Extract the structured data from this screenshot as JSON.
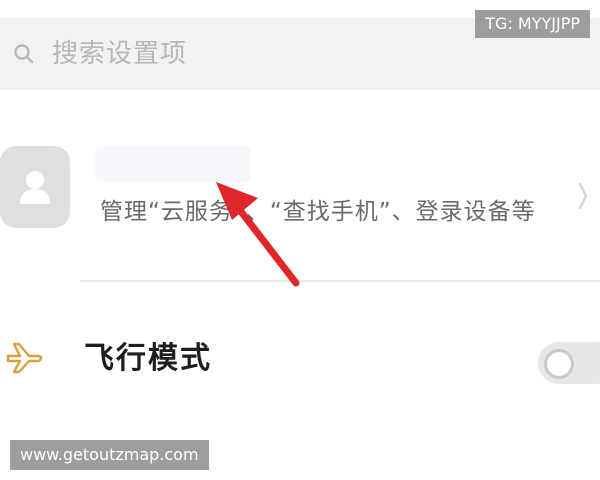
{
  "search": {
    "placeholder": "搜索设置项"
  },
  "watermarks": {
    "top": "TG: MYYJJPP",
    "bottom": "www.getoutzmap.com"
  },
  "account": {
    "description": "管理“云服务”、“查找手机”、登录设备等"
  },
  "airplane_mode": {
    "label": "飞行模式",
    "enabled": false
  },
  "icons": {
    "search": "search-icon",
    "avatar": "avatar-icon",
    "chevron": "chevron-right-icon",
    "airplane": "airplane-icon",
    "annotation": "red-arrow-annotation"
  },
  "colors": {
    "annotation_arrow": "#e1262b",
    "airplane_icon": "#d7a13d"
  }
}
